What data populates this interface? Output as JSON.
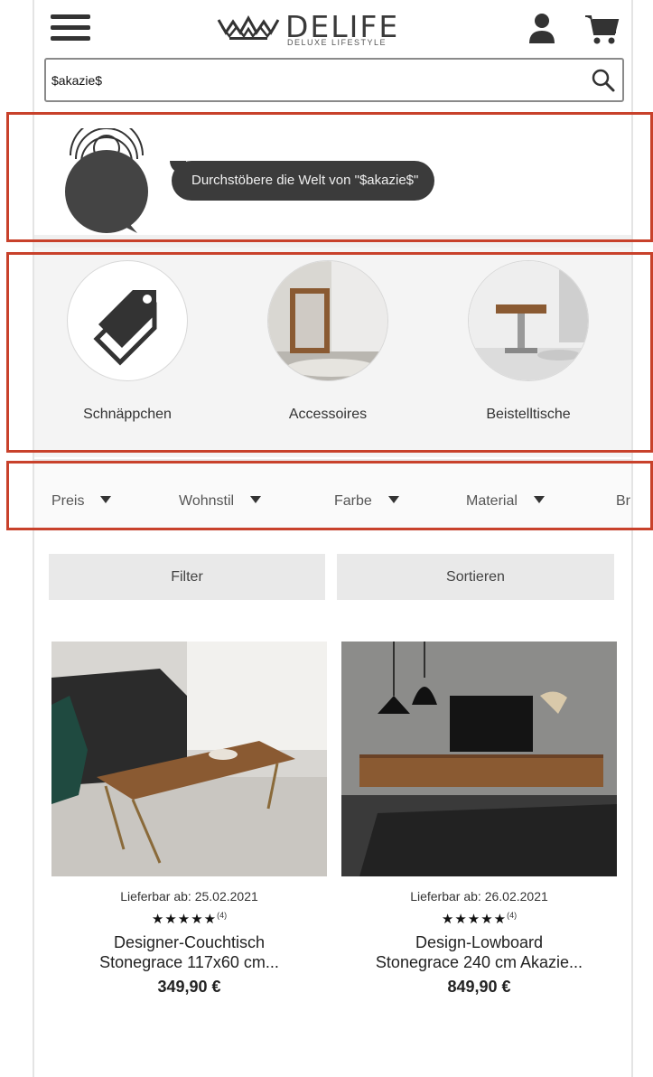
{
  "header": {
    "logo_text": "DELIFE",
    "logo_subtitle": "DELUXE LIFESTYLE"
  },
  "search": {
    "value": "$akazie$"
  },
  "voice": {
    "bubble_text": "Durchstöbere die Welt von \"$akazie$\""
  },
  "categories": [
    {
      "label": "Schnäppchen",
      "icon": "price-tags-icon"
    },
    {
      "label": "Accessoires",
      "icon": "mirror-photo"
    },
    {
      "label": "Beistelltische",
      "icon": "side-table-photo"
    }
  ],
  "facets": [
    {
      "label": "Preis"
    },
    {
      "label": "Wohnstil"
    },
    {
      "label": "Farbe"
    },
    {
      "label": "Material"
    },
    {
      "label": "Br"
    }
  ],
  "actions": {
    "filter_label": "Filter",
    "sort_label": "Sortieren"
  },
  "products": [
    {
      "delivery": "Lieferbar ab: 25.02.2021",
      "stars": "★★★★★",
      "rating_count": "(4)",
      "name_line1": "Designer-Couchtisch",
      "name_line2": "Stonegrace 117x60 cm...",
      "price": "349,90 €"
    },
    {
      "delivery": "Lieferbar ab: 26.02.2021",
      "stars": "★★★★★",
      "rating_count": "(4)",
      "name_line1": "Design-Lowboard",
      "name_line2": "Stonegrace 240 cm Akazie...",
      "price": "849,90 €"
    }
  ],
  "colors": {
    "highlight_border": "#c8412b",
    "bubble_bg": "#3b3b3b",
    "button_bg": "#e9e9e9"
  }
}
